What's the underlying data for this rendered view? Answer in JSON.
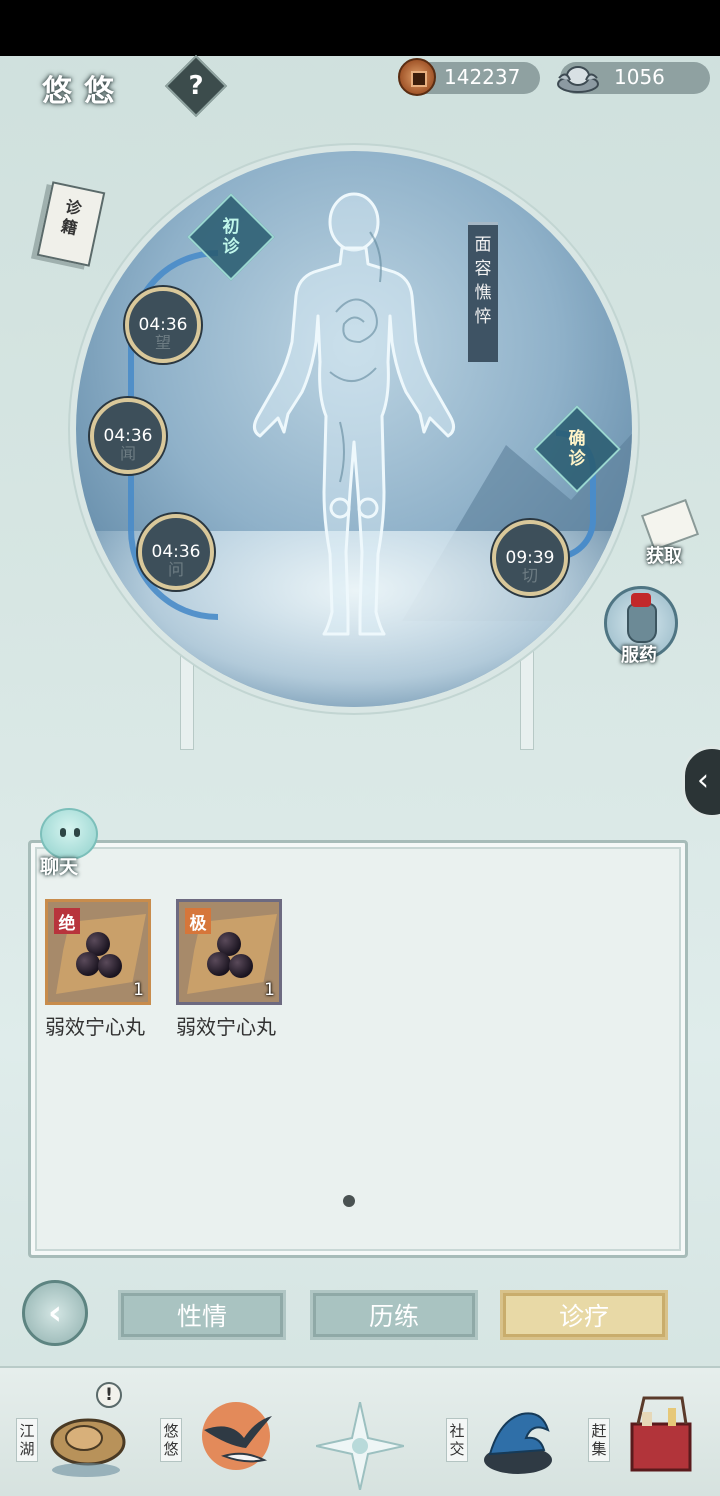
{
  "header": {
    "player_name": "悠悠",
    "help_label": "?",
    "copper_amount": "142237",
    "silver_amount": "1056"
  },
  "book": {
    "label": "诊籍"
  },
  "diagnosis": {
    "initial_tag": [
      "初",
      "诊"
    ],
    "confirm_tag": [
      "确",
      "诊"
    ],
    "banner": [
      "面",
      "容",
      "憔",
      "悴"
    ],
    "timers": [
      {
        "time": "04:36",
        "method": "望"
      },
      {
        "time": "04:36",
        "method": "闻"
      },
      {
        "time": "04:36",
        "method": "问"
      },
      {
        "time": "09:39",
        "method": "切"
      }
    ]
  },
  "side": {
    "get_label": "获取",
    "medicine_label": "服药",
    "collapse_icon": "‹"
  },
  "chat": {
    "label": "聊天"
  },
  "inventory": {
    "items": [
      {
        "grade": "绝",
        "name": "弱效宁心丸",
        "count": "1"
      },
      {
        "grade": "极",
        "name": "弱效宁心丸",
        "count": "1"
      }
    ]
  },
  "tabs": {
    "back_icon": "‹",
    "items": [
      "性情",
      "历练",
      "诊疗"
    ],
    "active": "诊疗"
  },
  "nav": {
    "items": [
      {
        "label": "江湖",
        "icon": "hat-icon"
      },
      {
        "label": "悠悠",
        "icon": "bird-icon"
      },
      {
        "label": "",
        "icon": "star-icon"
      },
      {
        "label": "社交",
        "icon": "wave-icon"
      },
      {
        "label": "赶集",
        "icon": "basket-icon"
      }
    ],
    "alert": "!"
  },
  "colors": {
    "accent_active_tab": "#e8d9a6",
    "timer_ring": "#4a8cc9",
    "grade_jue": "#b8343c",
    "grade_ji": "#d6763a"
  }
}
